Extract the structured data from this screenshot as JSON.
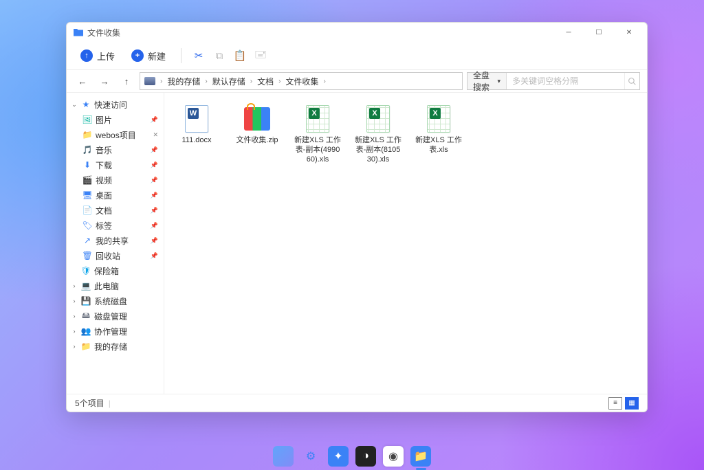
{
  "titlebar": {
    "title": "文件收集"
  },
  "toolbar": {
    "upload": "上传",
    "new": "新建",
    "actions": [
      "cut",
      "copy",
      "paste",
      "stamp"
    ]
  },
  "breadcrumb": [
    "我的存储",
    "默认存储",
    "文档",
    "文件收集"
  ],
  "search": {
    "scope": "全盘搜索",
    "placeholder": "多关键词空格分隔"
  },
  "sidebar": {
    "quick": {
      "label": "快速访问",
      "expanded": true
    },
    "quick_items": [
      {
        "label": "图片",
        "icon": "🖼",
        "pin": "📌",
        "color": "#14b8a6"
      },
      {
        "label": "webos项目",
        "icon": "📁",
        "pin": "✕",
        "color": "#3b82f6"
      },
      {
        "label": "音乐",
        "icon": "🎵",
        "pin": "📌",
        "color": "#3b82f6"
      },
      {
        "label": "下载",
        "icon": "⬇",
        "pin": "📌",
        "color": "#3b82f6"
      },
      {
        "label": "视频",
        "icon": "🎬",
        "pin": "📌",
        "color": "#3b82f6"
      },
      {
        "label": "桌面",
        "icon": "🖥",
        "pin": "📌",
        "color": "#3b82f6"
      },
      {
        "label": "文档",
        "icon": "📄",
        "pin": "📌",
        "color": "#3b82f6"
      },
      {
        "label": "标签",
        "icon": "🏷",
        "pin": "📌",
        "color": "#3b82f6"
      },
      {
        "label": "我的共享",
        "icon": "↗",
        "pin": "📌",
        "color": "#3b82f6"
      },
      {
        "label": "回收站",
        "icon": "🗑",
        "pin": "📌",
        "color": "#3b82f6"
      }
    ],
    "roots": [
      {
        "label": "保险箱",
        "icon": "🛡",
        "caret": "",
        "color": "#0ea5e9"
      },
      {
        "label": "此电脑",
        "icon": "💻",
        "caret": "›",
        "color": "#3b82f6"
      },
      {
        "label": "系统磁盘",
        "icon": "💾",
        "caret": "›",
        "color": "#6b7280"
      },
      {
        "label": "磁盘管理",
        "icon": "🖴",
        "caret": "›",
        "color": "#6b7280"
      },
      {
        "label": "协作管理",
        "icon": "👥",
        "caret": "›",
        "color": "#3b82f6"
      },
      {
        "label": "我的存储",
        "icon": "📁",
        "caret": "›",
        "color": "#3b82f6"
      }
    ]
  },
  "files": [
    {
      "name": "111.docx",
      "type": "doc"
    },
    {
      "name": "文件收集.zip",
      "type": "zip"
    },
    {
      "name": "新建XLS 工作表-副本(499060).xls",
      "type": "xls"
    },
    {
      "name": "新建XLS 工作表-副本(810530).xls",
      "type": "xls"
    },
    {
      "name": "新建XLS 工作表.xls",
      "type": "xls"
    }
  ],
  "status": {
    "count_text": "5个项目"
  }
}
